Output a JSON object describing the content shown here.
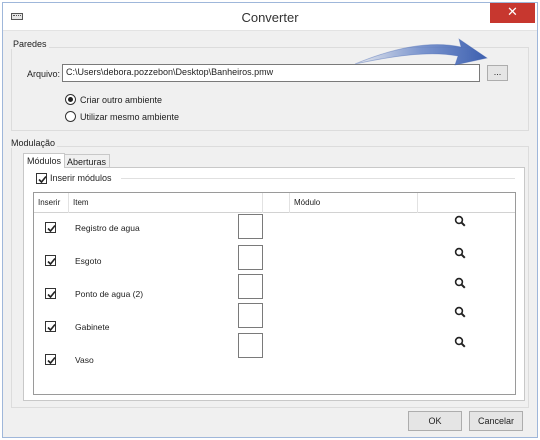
{
  "window": {
    "title": "Converter",
    "close_glyph": "✕"
  },
  "paredes": {
    "group_title": "Paredes",
    "arquivo_label": "Arquivo:",
    "arquivo_value": "C:\\Users\\debora.pozzebon\\Desktop\\Banheiros.pmw",
    "browse_label": "...",
    "radio_options": [
      {
        "label": "Criar outro ambiente",
        "checked": true
      },
      {
        "label": "Utilizar mesmo ambiente",
        "checked": false
      }
    ]
  },
  "modulacao": {
    "group_title": "Modulação",
    "tabs": [
      {
        "label": "Módulos",
        "active": true
      },
      {
        "label": "Aberturas",
        "active": false
      }
    ],
    "inserir_modulos_label": "Inserir módulos",
    "inserir_modulos_checked": true,
    "columns": [
      "Inserir",
      "Item",
      "",
      "Módulo",
      ""
    ],
    "rows": [
      {
        "checked": true,
        "item": "Registro de agua"
      },
      {
        "checked": true,
        "item": "Esgoto"
      },
      {
        "checked": true,
        "item": "Ponto de agua (2)"
      },
      {
        "checked": true,
        "item": "Gabinete"
      },
      {
        "checked": true,
        "item": "Vaso"
      }
    ],
    "search_icon": "search-icon"
  },
  "footer": {
    "ok_label": "OK",
    "cancel_label": "Cancelar"
  },
  "colors": {
    "close_button": "#c7372f",
    "arrow": "#4a6fc0"
  }
}
